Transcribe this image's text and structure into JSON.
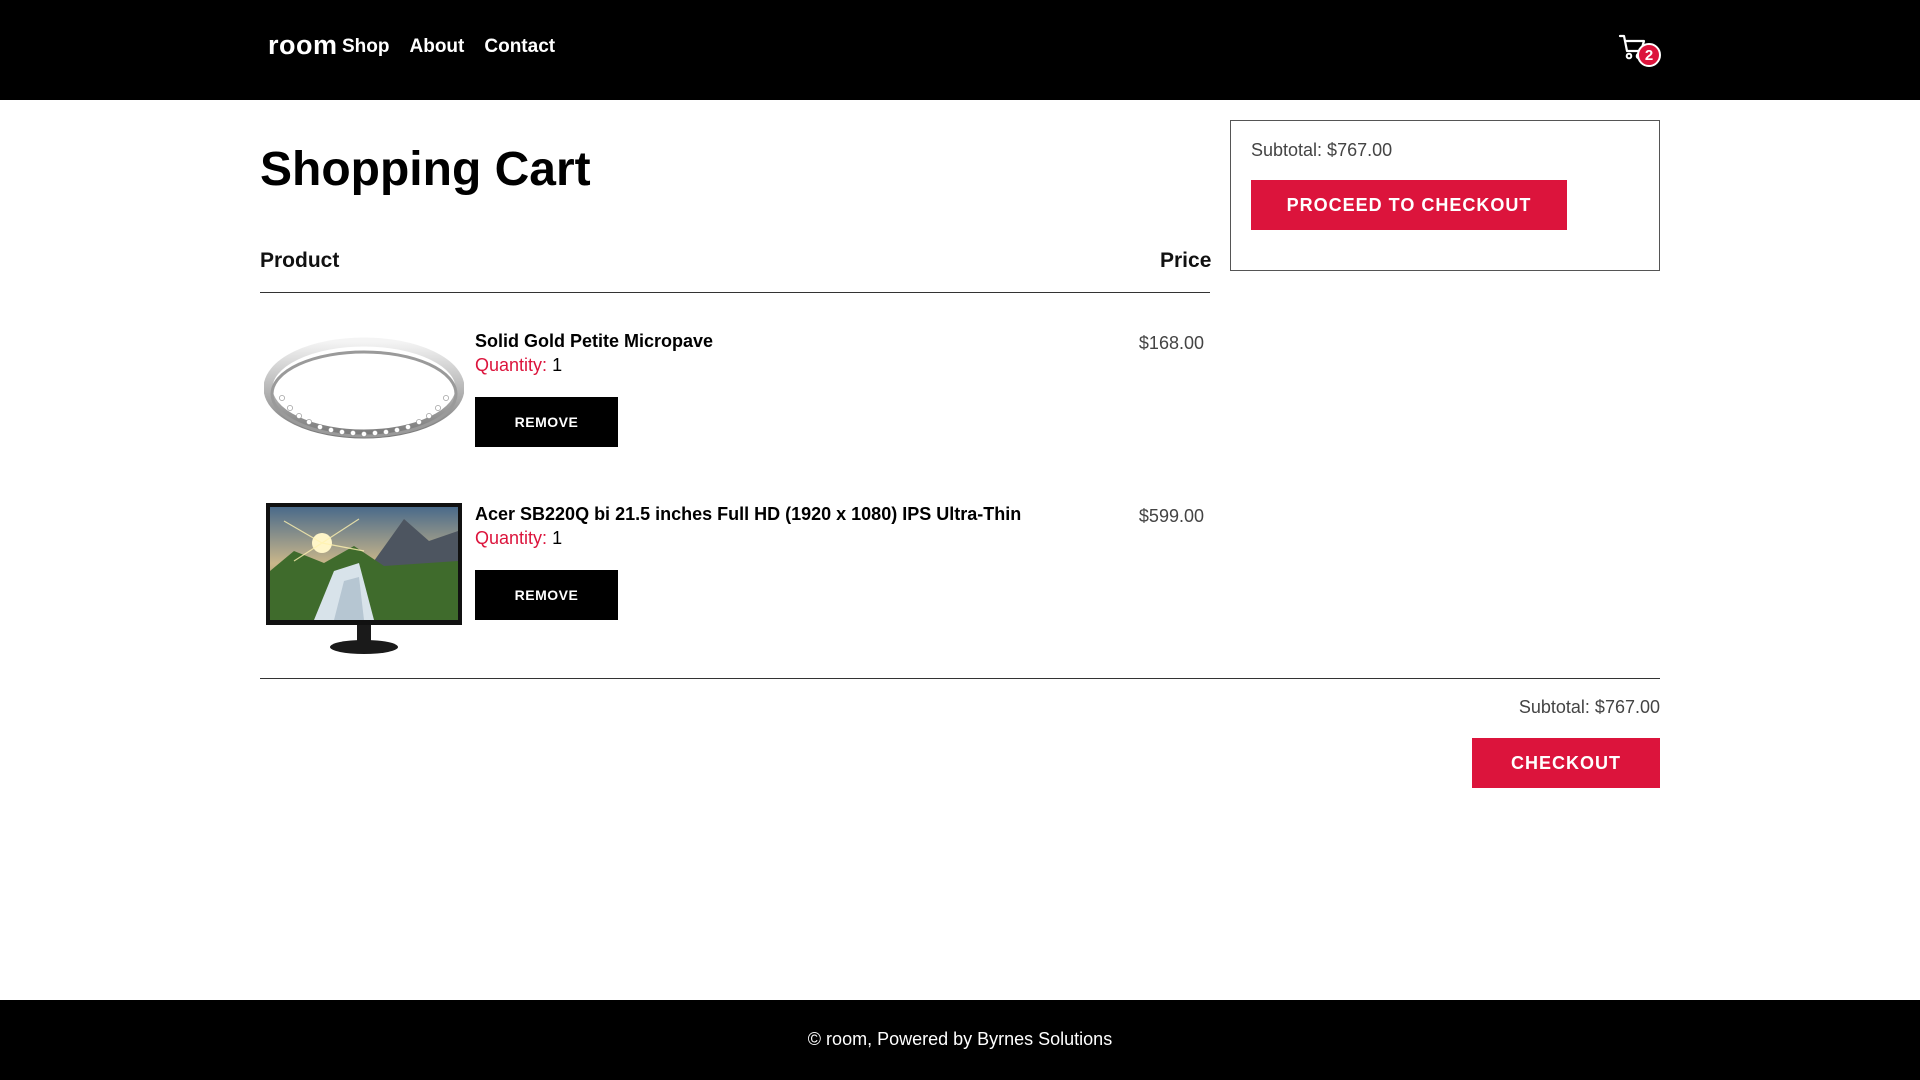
{
  "header": {
    "brand": "room",
    "nav": [
      "Shop",
      "About",
      "Contact"
    ],
    "cart_count": "2"
  },
  "page": {
    "title": "Shopping Cart",
    "col_product": "Product",
    "col_price": "Price"
  },
  "items": [
    {
      "name": "Solid Gold Petite Micropave",
      "quantity_label": "Quantity:",
      "quantity": "1",
      "remove_label": "REMOVE",
      "price": "$168.00",
      "image": "ring-image"
    },
    {
      "name": "Acer SB220Q bi 21.5 inches Full HD (1920 x 1080) IPS Ultra-Thin",
      "quantity_label": "Quantity:",
      "quantity": "1",
      "remove_label": "REMOVE",
      "price": "$599.00",
      "image": "monitor-image"
    }
  ],
  "summary": {
    "subtotal": "Subtotal: $767.00",
    "proceed_label": "PROCEED TO CHECKOUT"
  },
  "bottom": {
    "subtotal": "Subtotal: $767.00",
    "checkout_label": "CHECKOUT"
  },
  "footer": {
    "text": "© room, Powered by Byrnes Solutions"
  },
  "colors": {
    "accent": "#dc143c",
    "header_bg": "#000000",
    "footer_bg": "#000000"
  }
}
